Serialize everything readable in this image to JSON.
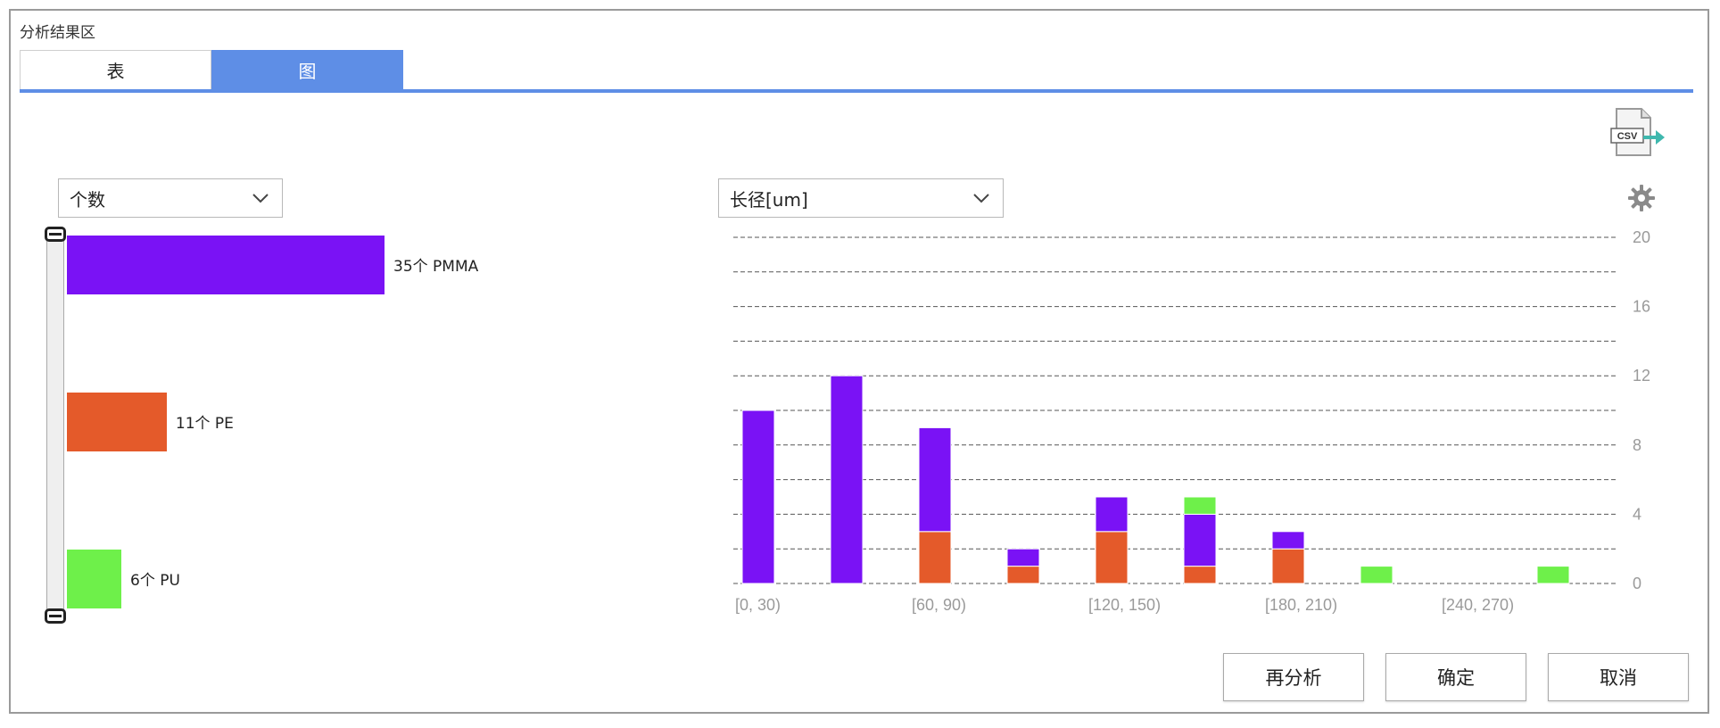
{
  "panel": {
    "title": "分析结果区"
  },
  "tabs": [
    {
      "label": "表",
      "active": false
    },
    {
      "label": "图",
      "active": true
    }
  ],
  "toolbar": {
    "export_icon": "csv-export-icon",
    "export_icon_text": "CSV",
    "settings_icon": "gear-icon"
  },
  "left_dropdown": {
    "value": "个数"
  },
  "right_dropdown": {
    "value": "长径[um]"
  },
  "colors": {
    "accent": "#5e8ee6",
    "PMMA": "#7a12f5",
    "PE": "#e45a2a",
    "PU": "#6ef04a"
  },
  "buttons": {
    "reanalyze": "再分析",
    "ok": "确定",
    "cancel": "取消"
  },
  "chart_data": [
    {
      "type": "bar",
      "orientation": "horizontal",
      "categories": [
        "PMMA",
        "PE",
        "PU"
      ],
      "values": [
        35,
        11,
        6
      ],
      "labels": [
        "35个 PMMA",
        "11个 PE",
        "6个 PU"
      ],
      "colors": [
        "#7a12f5",
        "#e45a2a",
        "#6ef04a"
      ]
    },
    {
      "type": "bar",
      "stacked": true,
      "categories": [
        "[0, 30)",
        "[30, 60)",
        "[60, 90)",
        "[90, 120)",
        "[120, 150)",
        "[150, 180)",
        "[180, 210)",
        "[210, 240)",
        "[240, 270)",
        "[270, 300)"
      ],
      "x_tick_labels": [
        "[0, 30)",
        "[60, 90)",
        "[120, 150)",
        "[180, 210)",
        "[240, 270)"
      ],
      "series": [
        {
          "color": "#e45a2a",
          "values": [
            0,
            0,
            3,
            1,
            3,
            1,
            2,
            0,
            0,
            0
          ]
        },
        {
          "color": "#7a12f5",
          "values": [
            10,
            12,
            6,
            1,
            2,
            3,
            1,
            0,
            0,
            0
          ]
        },
        {
          "color": "#6ef04a",
          "values": [
            0,
            0,
            0,
            0,
            0,
            1,
            0,
            1,
            0,
            1
          ]
        }
      ],
      "y_ticks": [
        0,
        4,
        8,
        12,
        16,
        20
      ],
      "ylim": [
        0,
        20
      ],
      "grid": true,
      "y_axis_side": "right"
    }
  ]
}
